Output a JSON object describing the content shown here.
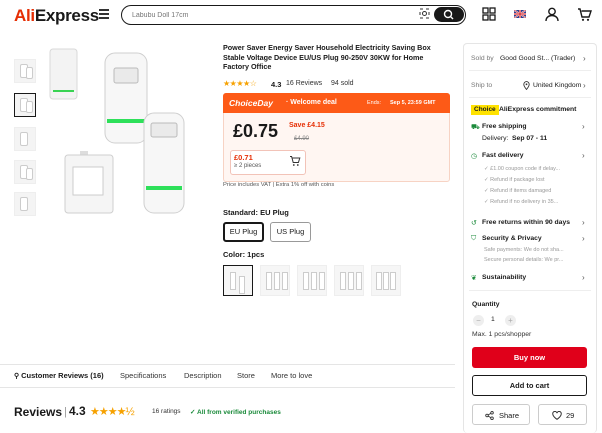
{
  "header": {
    "logo_a": "Ali",
    "logo_b": "Express",
    "search_placeholder": "Labubu Doll 17cm"
  },
  "product": {
    "title": "Power Saver Energy Saver Household Electricity Saving Box Stable Voltage Device EU/US Plug 90-250V 30KW for Home Factory Office",
    "stars": "★★★★☆",
    "rating": "4.3",
    "reviews": "16 Reviews",
    "sold": "94 sold"
  },
  "deal": {
    "choice_day": "ChoiceDay",
    "welcome": "· Welcome deal",
    "ends_label": "Ends:",
    "ends_value": "Sep 5, 23:59 GMT",
    "price": "£0.75",
    "save": "Save £4.15",
    "original": "£4.90",
    "coupon_price": "£0.71",
    "coupon_qty": "≥ 2 pieces",
    "included": "Price includes VAT | Extra 1% off with coins"
  },
  "standard": {
    "label": "Standard: EU Plug",
    "options": [
      "EU Plug",
      "US Plug"
    ]
  },
  "color": {
    "label": "Color: 1pcs"
  },
  "tabs": [
    "Customer Reviews (16)",
    "Specifications",
    "Description",
    "Store",
    "More to love"
  ],
  "reviews_section": {
    "heading": "Reviews",
    "rating": "4.3",
    "stars": "★★★★½",
    "count": "16 ratings",
    "verified": "✓ All from verified purchases"
  },
  "panel": {
    "sold_by_label": "Sold by",
    "sold_by_value": "Good Good St... (Trader)",
    "ship_to_label": "Ship to",
    "ship_to_value": "United Kingdom",
    "choice_tag": "Choice",
    "commitment": "AliExpress commitment",
    "free_shipping": "Free shipping",
    "delivery": "Delivery:",
    "delivery_date": "Sep 07 - 11",
    "fast_delivery": "Fast delivery",
    "fast_items": [
      "£1.00 coupon code if delay...",
      "Refund if package lost",
      "Refund if items damaged",
      "Refund if no delivery in 35..."
    ],
    "free_returns": "Free returns within 90 days",
    "security": "Security & Privacy",
    "security_items": [
      "Safe payments: We do not sha...",
      "Secure personal details: We pr..."
    ],
    "sustainability": "Sustainability",
    "quantity_label": "Quantity",
    "quantity": "1",
    "max": "Max. 1 pcs/shopper",
    "buy_now": "Buy now",
    "add_to_cart": "Add to cart",
    "share": "Share",
    "likes": "29"
  }
}
